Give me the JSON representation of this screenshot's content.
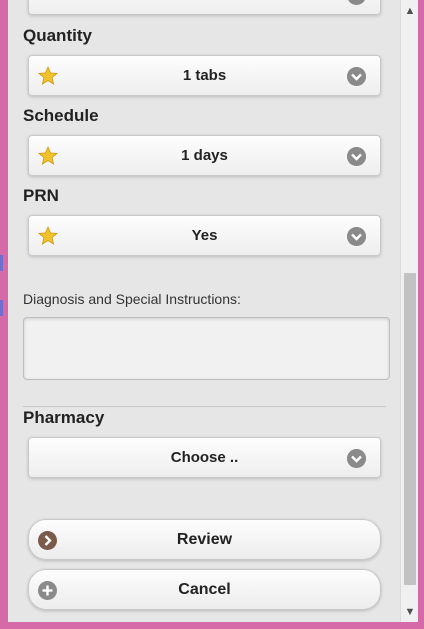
{
  "quantity": {
    "label": "Quantity",
    "value": "1 tabs"
  },
  "schedule": {
    "label": "Schedule",
    "value": "1 days"
  },
  "prn": {
    "label": "PRN",
    "value": "Yes"
  },
  "diagnosis": {
    "label": "Diagnosis and Special Instructions:",
    "value": ""
  },
  "pharmacy": {
    "label": "Pharmacy",
    "value": "Choose .."
  },
  "actions": {
    "review": "Review",
    "cancel": "Cancel"
  },
  "colors": {
    "accent_star": "#f2c12e",
    "chevron_bg": "#8a8a8a",
    "review_icon": "#7a5a4a",
    "frame": "#d66aa8"
  }
}
